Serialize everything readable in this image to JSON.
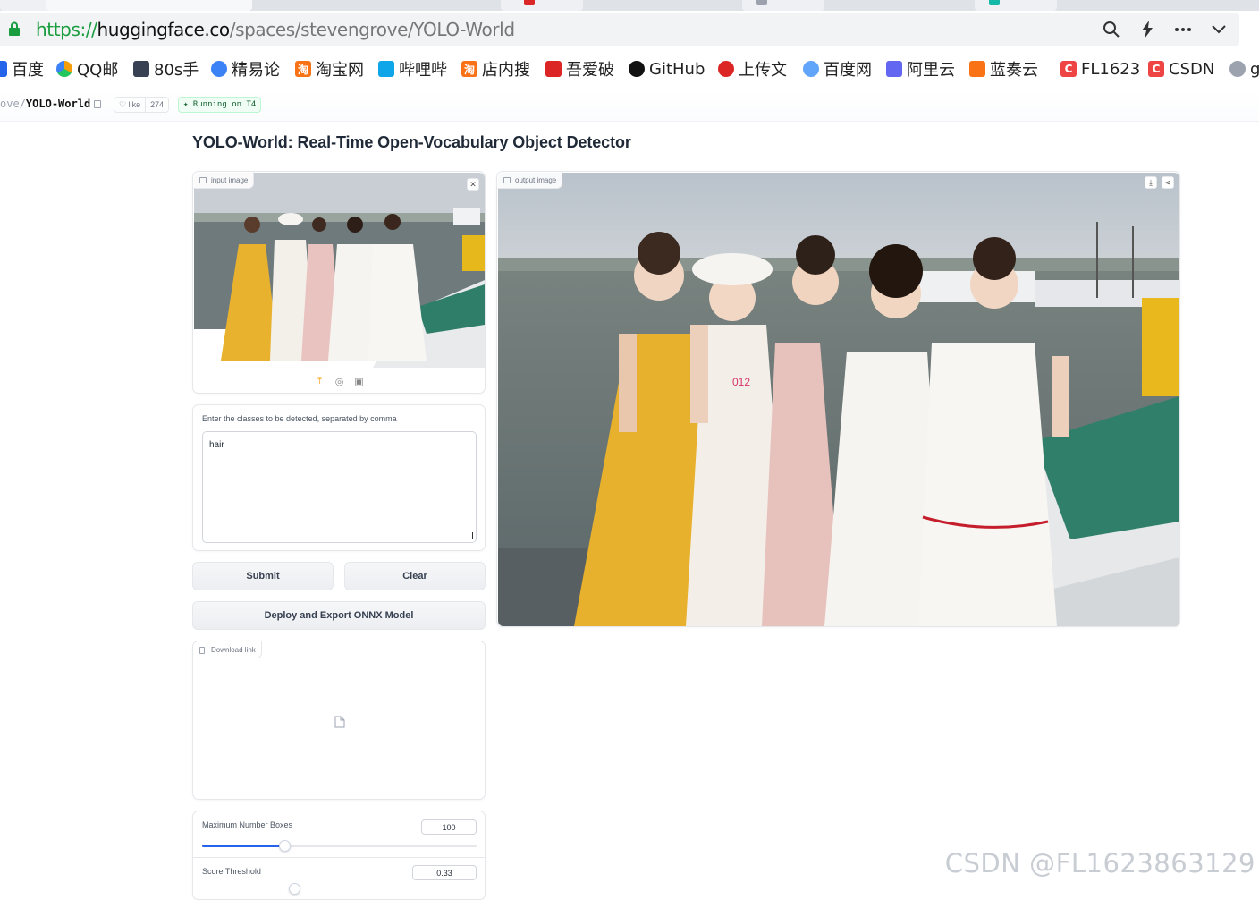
{
  "browser": {
    "url_scheme": "https://",
    "url_host": "huggingface.co",
    "url_path": "/spaces/stevengrove/YOLO-World",
    "bookmarks": [
      {
        "label": "百度",
        "color": "#2563eb"
      },
      {
        "label": "QQ邮",
        "color": "#f59e0b"
      },
      {
        "label": "80s手",
        "color": "#374151"
      },
      {
        "label": "精易论",
        "color": "#3b82f6"
      },
      {
        "label": "淘宝网",
        "color": "#f97316"
      },
      {
        "label": "哔哩哔",
        "color": "#0ea5e9"
      },
      {
        "label": "店内搜",
        "color": "#f97316"
      },
      {
        "label": "吾爱破",
        "color": "#dc2626"
      },
      {
        "label": "GitHub",
        "color": "#111111"
      },
      {
        "label": "上传文",
        "color": "#dc2626"
      },
      {
        "label": "百度网",
        "color": "#3b82f6"
      },
      {
        "label": "阿里云",
        "color": "#6366f1"
      },
      {
        "label": "蓝奏云",
        "color": "#f97316"
      },
      {
        "label": "FL1623",
        "color": "#ef4444"
      },
      {
        "label": "CSDN",
        "color": "#ef4444"
      },
      {
        "label": "g",
        "color": "#9ca3af"
      }
    ]
  },
  "space": {
    "owner": "ove",
    "name": "YOLO-World",
    "like_label": "like",
    "like_count": "274",
    "status": "Running on T4"
  },
  "app": {
    "title": "YOLO-World: Real-Time Open-Vocabulary Object Detector",
    "input_image_label": "input image",
    "output_image_label": "output image",
    "classes_label": "Enter the classes to be detected, separated by comma",
    "classes_value": "hair",
    "submit_label": "Submit",
    "clear_label": "Clear",
    "deploy_label": "Deploy and Export ONNX Model",
    "download_label": "Download link",
    "max_boxes_label": "Maximum Number Boxes",
    "max_boxes_value": "100",
    "max_boxes_fraction": 0.3,
    "score_label": "Score Threshold",
    "score_value": "0.33"
  },
  "watermark": "CSDN @FL1623863129"
}
